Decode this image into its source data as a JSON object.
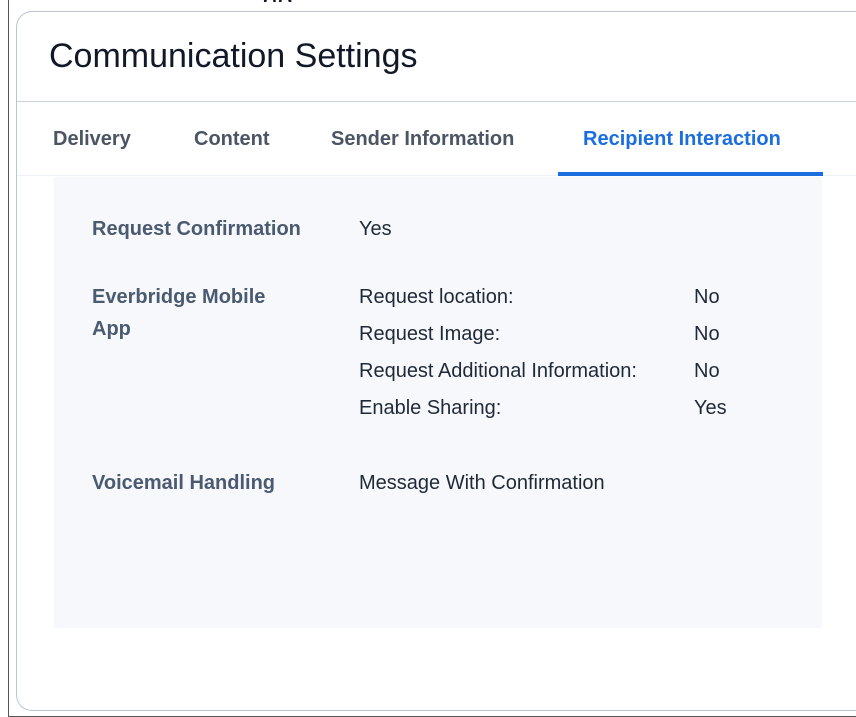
{
  "header": {
    "top_cut_text": "ng",
    "title": "Communication Settings"
  },
  "tabs": [
    {
      "label": "Delivery",
      "active": false
    },
    {
      "label": "Content",
      "active": false
    },
    {
      "label": "Sender Information",
      "active": false
    },
    {
      "label": "Recipient Interaction",
      "active": true
    }
  ],
  "settings": {
    "request_confirmation": {
      "label": "Request Confirmation",
      "value": "Yes"
    },
    "mobile_app": {
      "label_line1": "Everbridge Mobile",
      "label_line2": "App",
      "options": [
        {
          "label": "Request location:",
          "value": "No"
        },
        {
          "label": "Request Image:",
          "value": "No"
        },
        {
          "label": "Request Additional Information:",
          "value": "No"
        },
        {
          "label": "Enable Sharing:",
          "value": "Yes"
        }
      ]
    },
    "voicemail": {
      "label": "Voicemail Handling",
      "value": "Message With Confirmation"
    }
  },
  "colors": {
    "accent": "#1a6ee0",
    "label": "#4a5a70",
    "panel_bg": "#f6f8fb",
    "border": "#b9c4d4"
  }
}
